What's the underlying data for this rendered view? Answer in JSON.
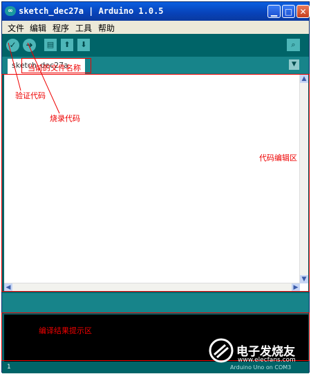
{
  "window": {
    "title": "sketch_dec27a | Arduino 1.0.5",
    "logo": "∞",
    "controls": {
      "minimize": "▁",
      "maximize": "□",
      "close": "✕"
    }
  },
  "menu": [
    "文件",
    "编辑",
    "程序",
    "工具",
    "帮助"
  ],
  "toolbar": {
    "buttons": [
      {
        "name": "verify",
        "glyph": "✓"
      },
      {
        "name": "upload",
        "glyph": "➔"
      },
      {
        "name": "new",
        "glyph": "▤"
      },
      {
        "name": "open",
        "glyph": "⬆"
      },
      {
        "name": "save",
        "glyph": "⬇"
      }
    ],
    "serial_monitor": "⌕"
  },
  "tab": {
    "label": "sketch_dec27a",
    "dropdown": "▼"
  },
  "editor": {
    "content": ""
  },
  "scroll": {
    "up": "▲",
    "down": "▼",
    "left": "◀",
    "right": "▶"
  },
  "statusbar": {
    "line": "1",
    "board": "Arduino Uno on COM3"
  },
  "annotations": {
    "filename": "当前的文件名称",
    "verify": "验证代码",
    "upload": "烧录代码",
    "editor": "代码编辑区",
    "console": "编译结果提示区"
  },
  "watermark": {
    "text": "电子发烧友",
    "url": "www.elecfans.com"
  },
  "colors": {
    "teal_dark": "#006468",
    "teal_mid": "#17848a",
    "teal_light": "#4db6b8",
    "annotation_red": "#e00000"
  }
}
